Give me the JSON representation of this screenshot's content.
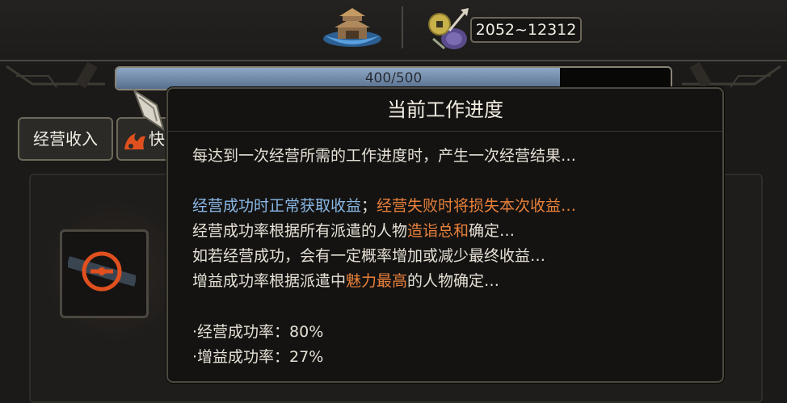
{
  "header": {
    "temple_icon": "temple-emblem-icon",
    "reward_icon": "coin-pouch-icon",
    "reward_range": "2052~12312"
  },
  "progress": {
    "label": "400/500",
    "current": 400,
    "max": 500,
    "fraction": 0.8,
    "fill_color": "#7d97b6"
  },
  "tabs": {
    "income_label": "经营收入",
    "quick_label": "快",
    "quick_icon": "flame-claw-icon"
  },
  "slot": {
    "icon": "sealed-compass-icon"
  },
  "tooltip": {
    "title": "当前工作进度",
    "line1": "每达到一次经营所需的工作进度时，产生一次经营结果…",
    "line2a": "经营成功时正常获取收益",
    "line2b": "；",
    "line2c": "经营失败时将损失本次收益…",
    "line3a": "经营成功率根据所有派遣的人物",
    "line3b": "造诣总和",
    "line3c": "确定…",
    "line4": "如若经营成功，会有一定概率增加或减少最终收益…",
    "line5a": "增益成功率根据派遣中",
    "line5b": "魅力最高",
    "line5c": "的人物确定…",
    "stat1": "·经营成功率：80%",
    "stat2": "·增益成功率：27%"
  },
  "colors": {
    "positive_blue": "#8ab8e6",
    "highlight_orange": "#e8803a"
  }
}
